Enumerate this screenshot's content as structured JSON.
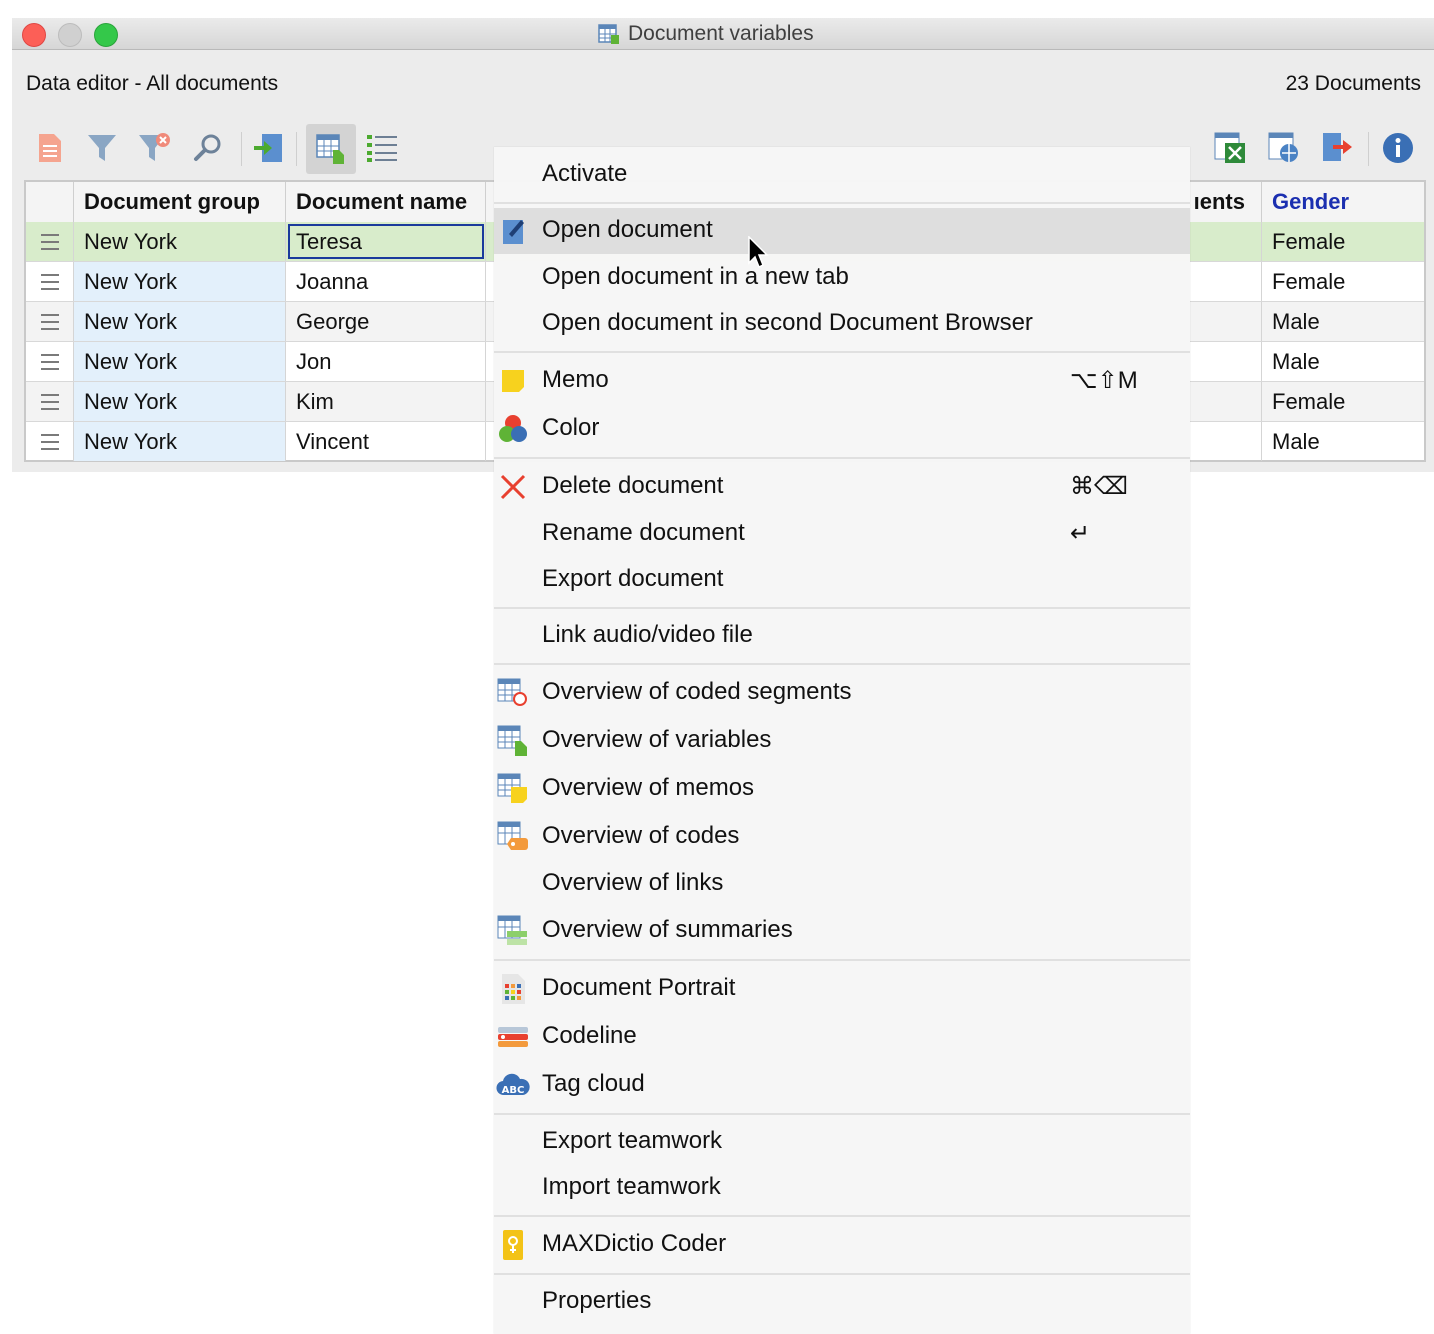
{
  "window": {
    "title": "Document variables",
    "subtitle": "Data editor - All documents",
    "doc_count": "23 Documents"
  },
  "toolbar": {
    "left_icons": [
      "new-document-icon",
      "filter-icon",
      "clear-filter-icon",
      "search-icon",
      "import-icon",
      "variables-view-icon",
      "list-view-icon"
    ],
    "right_icons": [
      "export-excel-icon",
      "export-html-icon",
      "export-icon",
      "info-icon"
    ]
  },
  "table": {
    "headers": {
      "group": "Document group",
      "name": "Document name",
      "partial": "ıents",
      "gender": "Gender"
    },
    "rows": [
      {
        "group": "New York",
        "name": "Teresa",
        "gender": "Female"
      },
      {
        "group": "New York",
        "name": "Joanna",
        "gender": "Female"
      },
      {
        "group": "New York",
        "name": "George",
        "gender": "Male"
      },
      {
        "group": "New York",
        "name": "Jon",
        "gender": "Male"
      },
      {
        "group": "New York",
        "name": "Kim",
        "gender": "Female"
      },
      {
        "group": "New York",
        "name": "Vincent",
        "gender": "Male"
      }
    ]
  },
  "menu": {
    "activate": "Activate",
    "open_document": "Open document",
    "open_new_tab": "Open document in a new tab",
    "open_second_browser": "Open document in second Document Browser",
    "memo": "Memo",
    "memo_shortcut": "⌥⇧M",
    "color": "Color",
    "delete_document": "Delete document",
    "delete_shortcut": "⌘⌫",
    "rename_document": "Rename document",
    "rename_shortcut": "↵",
    "export_document": "Export document",
    "link_av": "Link audio/video file",
    "ov_coded_segments": "Overview of coded segments",
    "ov_variables": "Overview of variables",
    "ov_memos": "Overview of memos",
    "ov_codes": "Overview of codes",
    "ov_links": "Overview of links",
    "ov_summaries": "Overview of summaries",
    "document_portrait": "Document Portrait",
    "codeline": "Codeline",
    "tag_cloud": "Tag cloud",
    "export_teamwork": "Export teamwork",
    "import_teamwork": "Import teamwork",
    "maxdictio": "MAXDictio Coder",
    "properties": "Properties"
  },
  "colors": {
    "selected_row": "#d8eccb",
    "group_cell": "#e3f0fb",
    "gender_header": "#1b2fb0"
  }
}
